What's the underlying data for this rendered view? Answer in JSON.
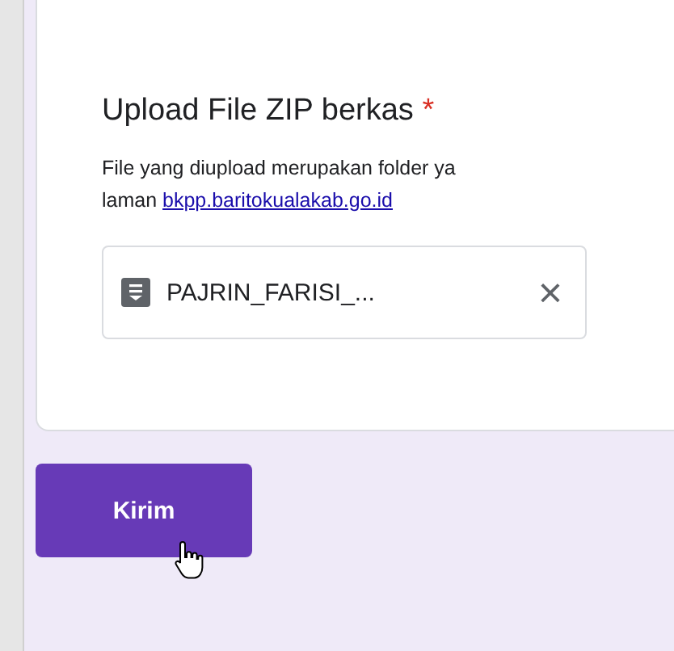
{
  "question": {
    "title": "Upload File ZIP berkas",
    "required_mark": "*",
    "description": "File yang diupload merupakan folder ya",
    "description_line2_prefix": "laman",
    "link": "bkpp.baritokualakab.go.id"
  },
  "uploaded_file": {
    "name": "PAJRIN_FARISI_...",
    "remove_label": "×"
  },
  "submit_button": "Kirim"
}
